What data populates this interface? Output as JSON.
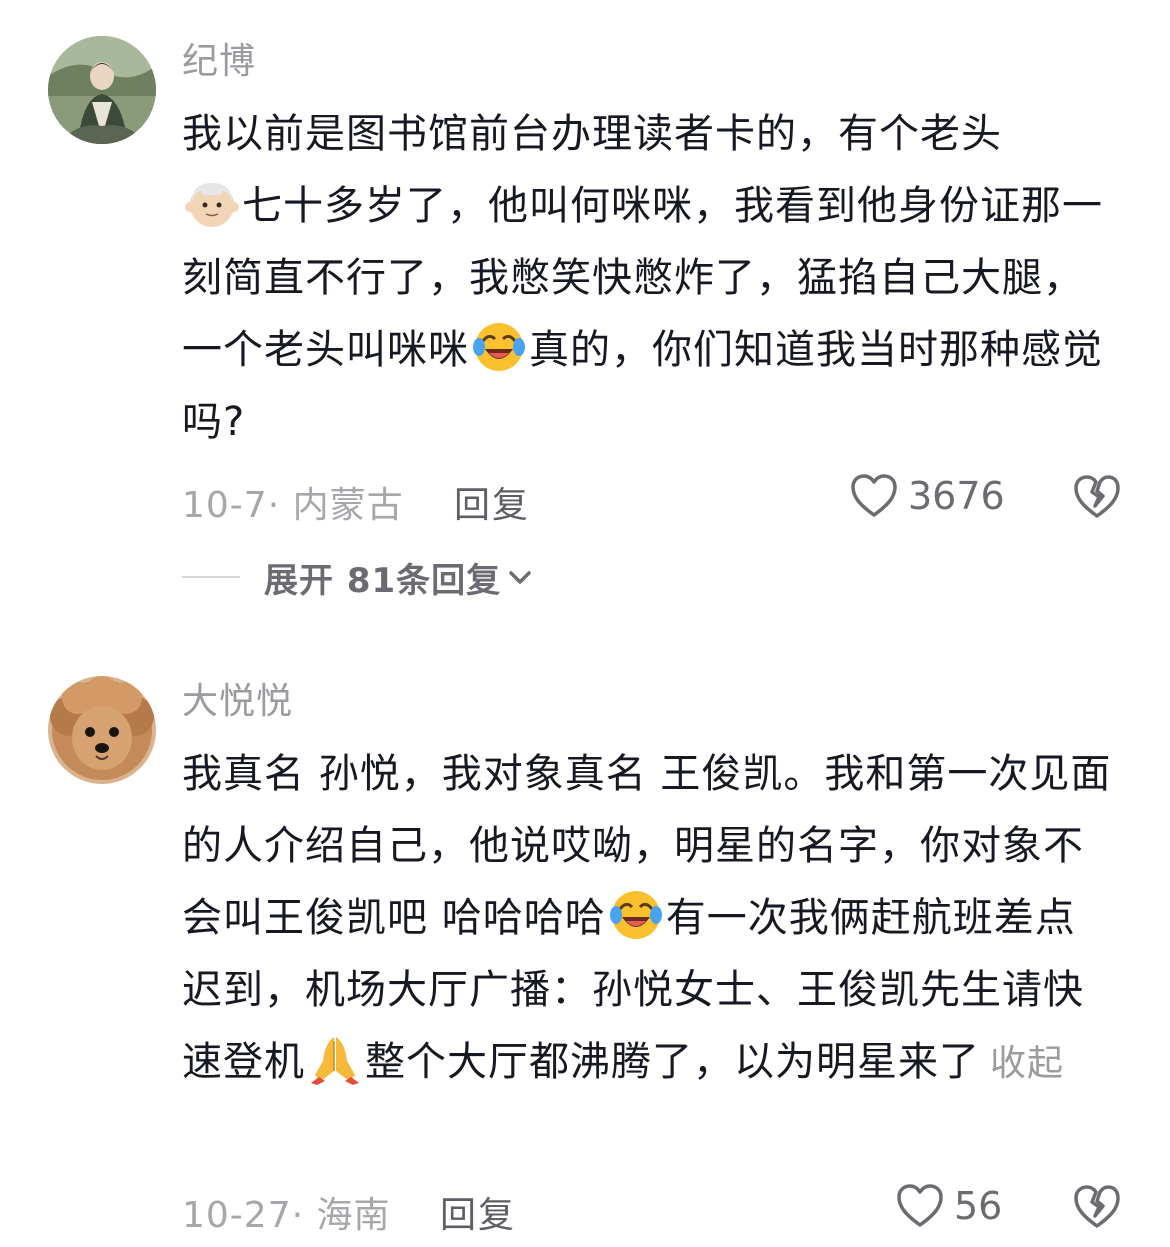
{
  "comments": [
    {
      "username": "纪博",
      "text_parts": [
        "我以前是图书馆前台办理读者卡的，有个老头",
        "七十多岁了，他叫何咪咪，我看到他身份证那一刻简直不行了，我憋笑快憋炸了，猛掐自己大腿，一个老头叫咪咪",
        "真的，你们知道我当时那种感觉吗?"
      ],
      "date_location": "10-7· 内蒙古",
      "reply_label": "回复",
      "like_count": "3676"
    },
    {
      "username": "大悦悦",
      "text_parts": [
        "我真名 孙悦，我对象真名 王俊凯。我和第一次见面的人介绍自己，他说哎呦，明星的名字，你对象不会叫王俊凯吧  哈哈哈哈",
        "有一次我俩赶航班差点迟到，机场大厅广播：孙悦女士、王俊凯先生请快速登机",
        "整个大厅都沸腾了，以为明星来了"
      ],
      "collapse_label": "收起",
      "date_location": "10-27· 海南",
      "reply_label": "回复",
      "like_count": "56"
    }
  ],
  "expand_replies_label": "展开 81条回复",
  "icons": {
    "like": "heart-outline-icon",
    "dislike": "broken-heart-icon",
    "chevron": "chevron-down-icon",
    "emoji_old_man": "old-man-emoji",
    "emoji_laugh": "rolling-laughing-emoji",
    "emoji_pray": "folded-hands-emoji"
  }
}
